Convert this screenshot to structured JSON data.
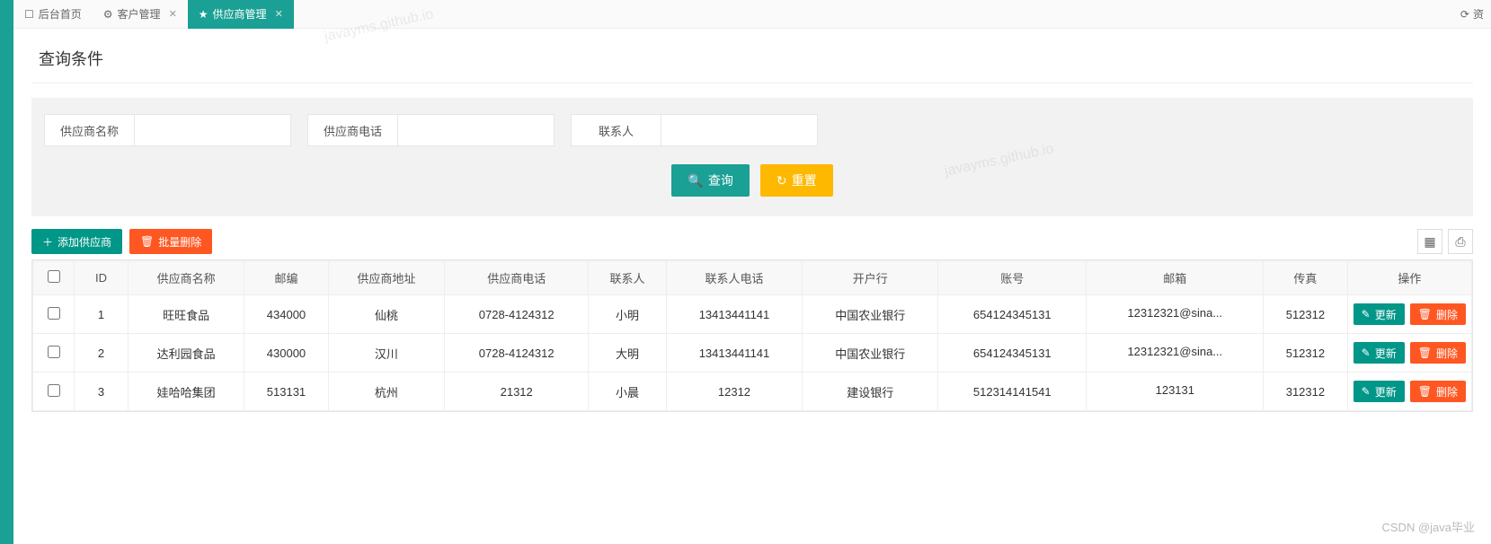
{
  "tabs": {
    "home": "后台首页",
    "customer": "客户管理",
    "supplier": "供应商管理",
    "right": "资"
  },
  "legend": "查询条件",
  "search": {
    "name_label": "供应商名称",
    "phone_label": "供应商电话",
    "contact_label": "联系人",
    "query_btn": "查询",
    "reset_btn": "重置"
  },
  "toolbar": {
    "add": "添加供应商",
    "batch_delete": "批量删除"
  },
  "table": {
    "headers": {
      "id": "ID",
      "name": "供应商名称",
      "zip": "邮编",
      "address": "供应商地址",
      "phone": "供应商电话",
      "contact": "联系人",
      "contact_phone": "联系人电话",
      "bank": "开户行",
      "account": "账号",
      "email": "邮箱",
      "fax": "传真",
      "op": "操作"
    },
    "rows": [
      {
        "id": "1",
        "name": "旺旺食品",
        "zip": "434000",
        "address": "仙桃",
        "phone": "0728-4124312",
        "contact": "小明",
        "contact_phone": "13413441141",
        "bank": "中国农业银行",
        "account": "654124345131",
        "email": "12312321@sina...",
        "fax": "512312"
      },
      {
        "id": "2",
        "name": "达利园食品",
        "zip": "430000",
        "address": "汉川",
        "phone": "0728-4124312",
        "contact": "大明",
        "contact_phone": "13413441141",
        "bank": "中国农业银行",
        "account": "654124345131",
        "email": "12312321@sina...",
        "fax": "512312"
      },
      {
        "id": "3",
        "name": "娃哈哈集团",
        "zip": "513131",
        "address": "杭州",
        "phone": "21312",
        "contact": "小晨",
        "contact_phone": "12312",
        "bank": "建设银行",
        "account": "512314141541",
        "email": "123131",
        "fax": "312312"
      }
    ],
    "update_btn": "更新",
    "delete_btn": "删除"
  },
  "watermark": "CSDN @java毕业",
  "wm_diag": "javayms.github.io"
}
